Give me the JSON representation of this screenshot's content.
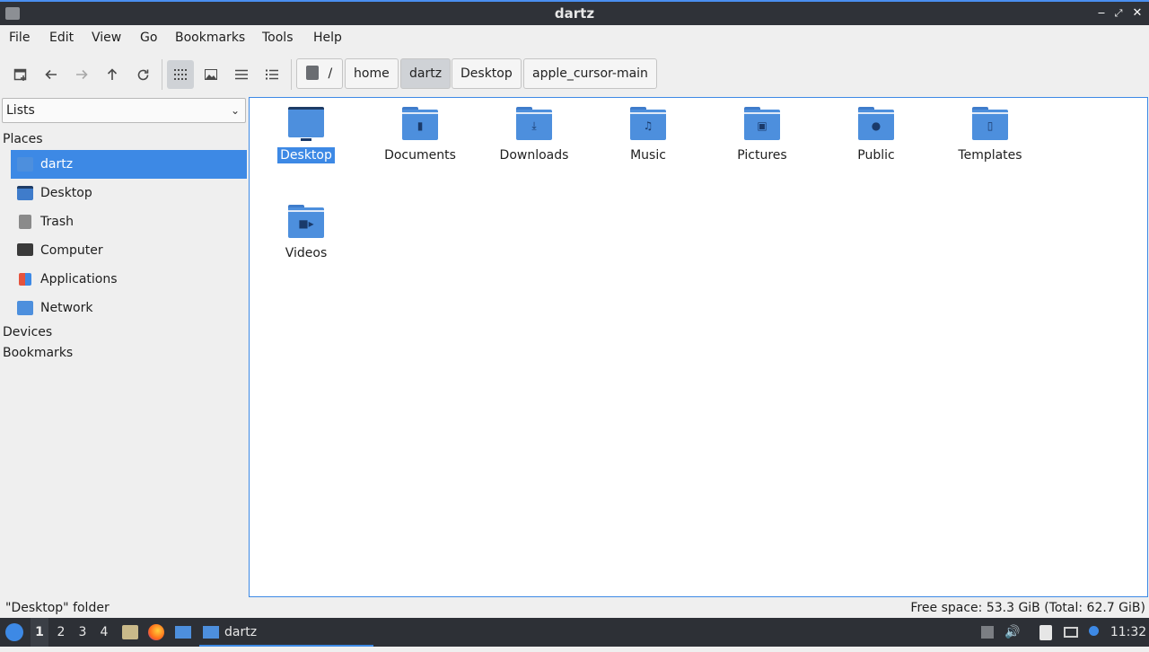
{
  "window": {
    "title": "dartz"
  },
  "menu": [
    "File",
    "Edit",
    "View",
    "Go",
    "Bookmarks",
    "Tools",
    "Help"
  ],
  "toolbar": {
    "buttons": [
      "new-tab-icon",
      "back-arrow-icon",
      "forward-arrow-icon",
      "up-arrow-icon",
      "reload-icon",
      "icon-view-icon",
      "thumbnail-view-icon",
      "compact-view-icon",
      "detailed-list-icon"
    ],
    "active_view": "icon-view-icon"
  },
  "breadcrumb": {
    "root": "/",
    "items": [
      "home",
      "dartz",
      "Desktop",
      "apple_cursor-main"
    ],
    "current": "dartz"
  },
  "sidebar": {
    "selector": "Lists",
    "places_label": "Places",
    "places": [
      "dartz",
      "Desktop",
      "Trash",
      "Computer",
      "Applications",
      "Network"
    ],
    "selected": "dartz",
    "devices_label": "Devices",
    "bookmarks_label": "Bookmarks"
  },
  "files": [
    {
      "name": "Desktop",
      "icon": "desktop-folder-icon",
      "selected": true
    },
    {
      "name": "Documents",
      "icon": "documents-folder-icon"
    },
    {
      "name": "Downloads",
      "icon": "downloads-folder-icon"
    },
    {
      "name": "Music",
      "icon": "music-folder-icon"
    },
    {
      "name": "Pictures",
      "icon": "pictures-folder-icon"
    },
    {
      "name": "Public",
      "icon": "public-folder-icon"
    },
    {
      "name": "Templates",
      "icon": "templates-folder-icon"
    },
    {
      "name": "Videos",
      "icon": "videos-folder-icon"
    }
  ],
  "status": {
    "left": "\"Desktop\" folder",
    "right": "Free space: 53.3 GiB (Total: 62.7 GiB)"
  },
  "taskbar": {
    "workspaces": [
      "1",
      "2",
      "3",
      "4"
    ],
    "active_workspace": "1",
    "task_label": "dartz",
    "clock": "11:32"
  },
  "colors": {
    "accent": "#3d89e5",
    "titlebar": "#2f3238",
    "taskbar": "#2d3036",
    "folder": "#4d8fdd"
  }
}
